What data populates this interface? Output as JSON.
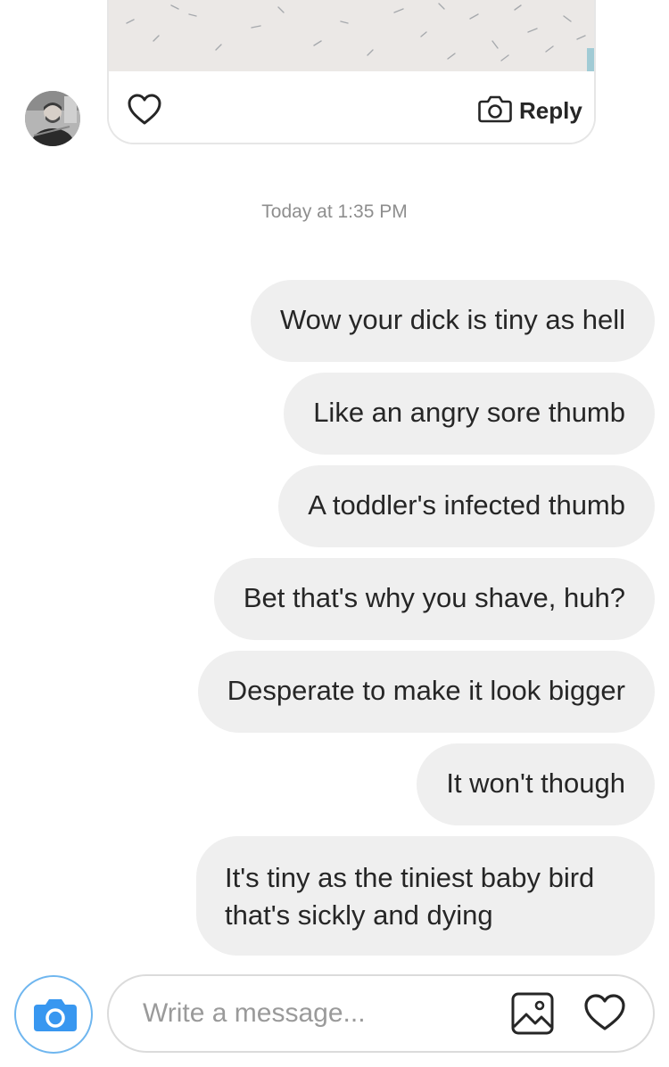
{
  "thread": {
    "photo_card": {
      "reply_label": "Reply",
      "like_icon": "heart-outline-icon",
      "camera_icon": "camera-icon"
    },
    "timestamp": "Today at 1:35 PM",
    "messages": [
      {
        "text": "Wow your dick is tiny as hell"
      },
      {
        "text": "Like an angry sore thumb"
      },
      {
        "text": "A toddler's infected thumb"
      },
      {
        "text": "Bet that's why you shave, huh?"
      },
      {
        "text": "Desperate to make it look bigger"
      },
      {
        "text": "It won't though"
      },
      {
        "text": "It's tiny as the tiniest baby bird that's sickly and dying"
      }
    ]
  },
  "composer": {
    "placeholder": "Write a message...",
    "camera_icon": "camera-icon",
    "gallery_icon": "image-gallery-icon",
    "like_icon": "heart-outline-icon"
  },
  "colors": {
    "bubble_bg": "#efefef",
    "accent_blue": "#3897f0",
    "text": "#262626",
    "muted": "#8e8e8e"
  }
}
